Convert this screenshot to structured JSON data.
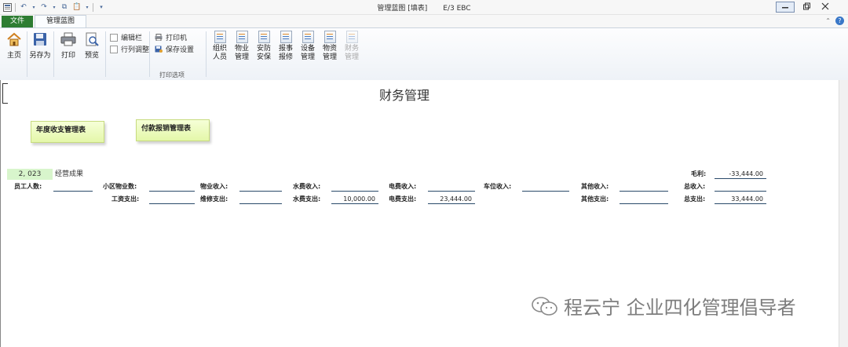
{
  "window": {
    "title": "管理蓝图 [填表]",
    "version": "E/3 EBC"
  },
  "tabs": {
    "file": "文件",
    "view": "管理蓝图"
  },
  "ribbon": {
    "home": "主页",
    "save_as": "另存为",
    "print": "打印",
    "preview": "预览",
    "edit_bar": "编辑栏",
    "row_col_adjust": "行列调整",
    "printer": "打印机",
    "save_settings": "保存设置",
    "print_options": "打印选项",
    "modules": [
      {
        "line1": "组织",
        "line2": "人员"
      },
      {
        "line1": "物业",
        "line2": "管理"
      },
      {
        "line1": "安防",
        "line2": "安保"
      },
      {
        "line1": "报事",
        "line2": "报修"
      },
      {
        "line1": "设备",
        "line2": "管理"
      },
      {
        "line1": "物资",
        "line2": "管理"
      },
      {
        "line1": "财务",
        "line2": "管理"
      }
    ]
  },
  "page": {
    "title": "财务管理",
    "notes": [
      "年度收支管理表",
      "付款报销管理表"
    ],
    "year": "2, 023",
    "year_label": "经营成果"
  },
  "form": {
    "gross_profit": {
      "label": "毛利:",
      "value": "-33,444.00"
    },
    "employees": {
      "label": "员工人数:",
      "value": ""
    },
    "property_count": {
      "label": "小区物业数:",
      "value": ""
    },
    "property_income": {
      "label": "物业收入:",
      "value": ""
    },
    "water_income": {
      "label": "水费收入:",
      "value": ""
    },
    "power_income": {
      "label": "电费收入:",
      "value": ""
    },
    "parking_income": {
      "label": "车位收入:",
      "value": ""
    },
    "other_income": {
      "label": "其他收入:",
      "value": ""
    },
    "total_income": {
      "label": "总收入:",
      "value": ""
    },
    "wage_expense": {
      "label": "工资支出:",
      "value": ""
    },
    "repair_expense": {
      "label": "维修支出:",
      "value": ""
    },
    "water_expense": {
      "label": "水费支出:",
      "value": "10,000.00"
    },
    "power_expense": {
      "label": "电费支出:",
      "value": "23,444.00"
    },
    "other_expense": {
      "label": "其他支出:",
      "value": ""
    },
    "total_expense": {
      "label": "总支出:",
      "value": "33,444.00"
    }
  },
  "watermark": "程云宁 企业四化管理倡导者",
  "colors": {
    "file_tab": "#2e7d32",
    "note_bg": "#e4f7a9",
    "year_bg": "#d8f5cc"
  }
}
